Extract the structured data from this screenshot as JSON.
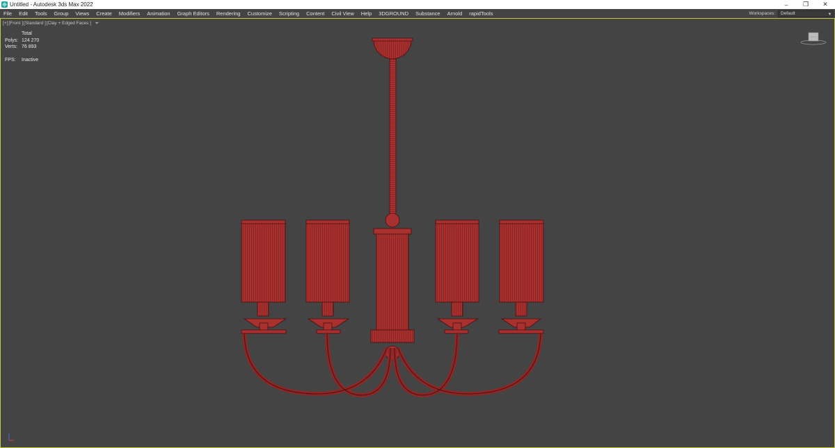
{
  "window": {
    "title": "Untitled - Autodesk 3ds Max 2022",
    "controls": {
      "minimize": "–",
      "restore": "❐",
      "close": "✕"
    }
  },
  "menu": {
    "items": [
      "File",
      "Edit",
      "Tools",
      "Group",
      "Views",
      "Create",
      "Modifiers",
      "Animation",
      "Graph Editors",
      "Rendering",
      "Customize",
      "Scripting",
      "Content",
      "Civil View",
      "Help",
      "3DGROUND",
      "Substance",
      "Arnold",
      "rapidTools"
    ],
    "workspaces_label": "Workspaces:",
    "workspace_value": "Default"
  },
  "viewport": {
    "labels": [
      "[+]",
      "[Front ]",
      "[Standard ]",
      "[Clay + Edged Faces ]"
    ],
    "filter_icon": "funnel-icon",
    "stats": {
      "header": "Total",
      "polys_label": "Polys:",
      "polys_value": "124 270",
      "verts_label": "Verts:",
      "verts_value": "76 893",
      "fps_label": "FPS:",
      "fps_value": "Inactive"
    },
    "viewcube_icon": "viewcube-icon",
    "axis_icon": "axis-tripod-icon",
    "colors": {
      "background": "#444444",
      "active_border": "#c9c74a",
      "model_fill": "#a8302e",
      "model_wire": "#4a0f0f"
    }
  }
}
